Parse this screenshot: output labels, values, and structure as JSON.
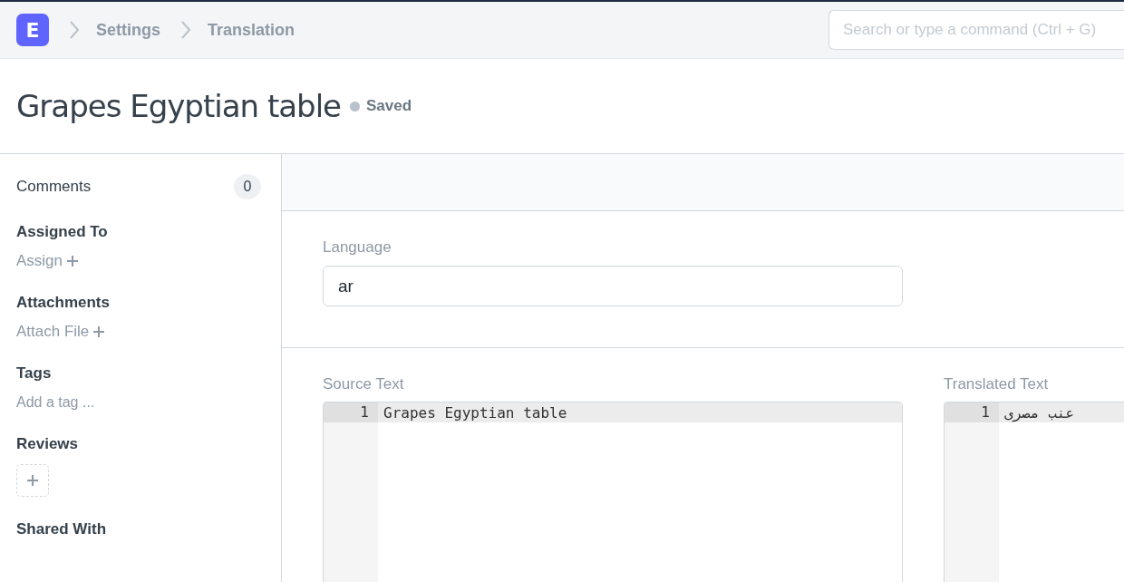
{
  "navbar": {
    "logo": "E",
    "breadcrumbs": [
      "Settings",
      "Translation"
    ],
    "search": {
      "placeholder": "Search or type a command (Ctrl + G)"
    }
  },
  "page": {
    "title": "Grapes Egyptian table",
    "status": "Saved"
  },
  "sidebar": {
    "comments": {
      "label": "Comments",
      "count": "0"
    },
    "sections": [
      {
        "kind": "action",
        "heading": "Assigned To",
        "action": "Assign"
      },
      {
        "kind": "action",
        "heading": "Attachments",
        "action": "Attach File"
      },
      {
        "kind": "tag",
        "heading": "Tags",
        "action": "Add a tag ..."
      },
      {
        "kind": "review",
        "heading": "Reviews"
      },
      {
        "kind": "heading",
        "heading": "Shared With"
      }
    ]
  },
  "form": {
    "language": {
      "label": "Language",
      "value": "ar"
    },
    "editors": [
      {
        "label": "Source Text",
        "lines": [
          {
            "number": "1",
            "text": "Grapes Egyptian table"
          }
        ]
      },
      {
        "label": "Translated Text",
        "lines": [
          {
            "number": "1",
            "text": "عنب مصرى"
          }
        ]
      }
    ]
  }
}
